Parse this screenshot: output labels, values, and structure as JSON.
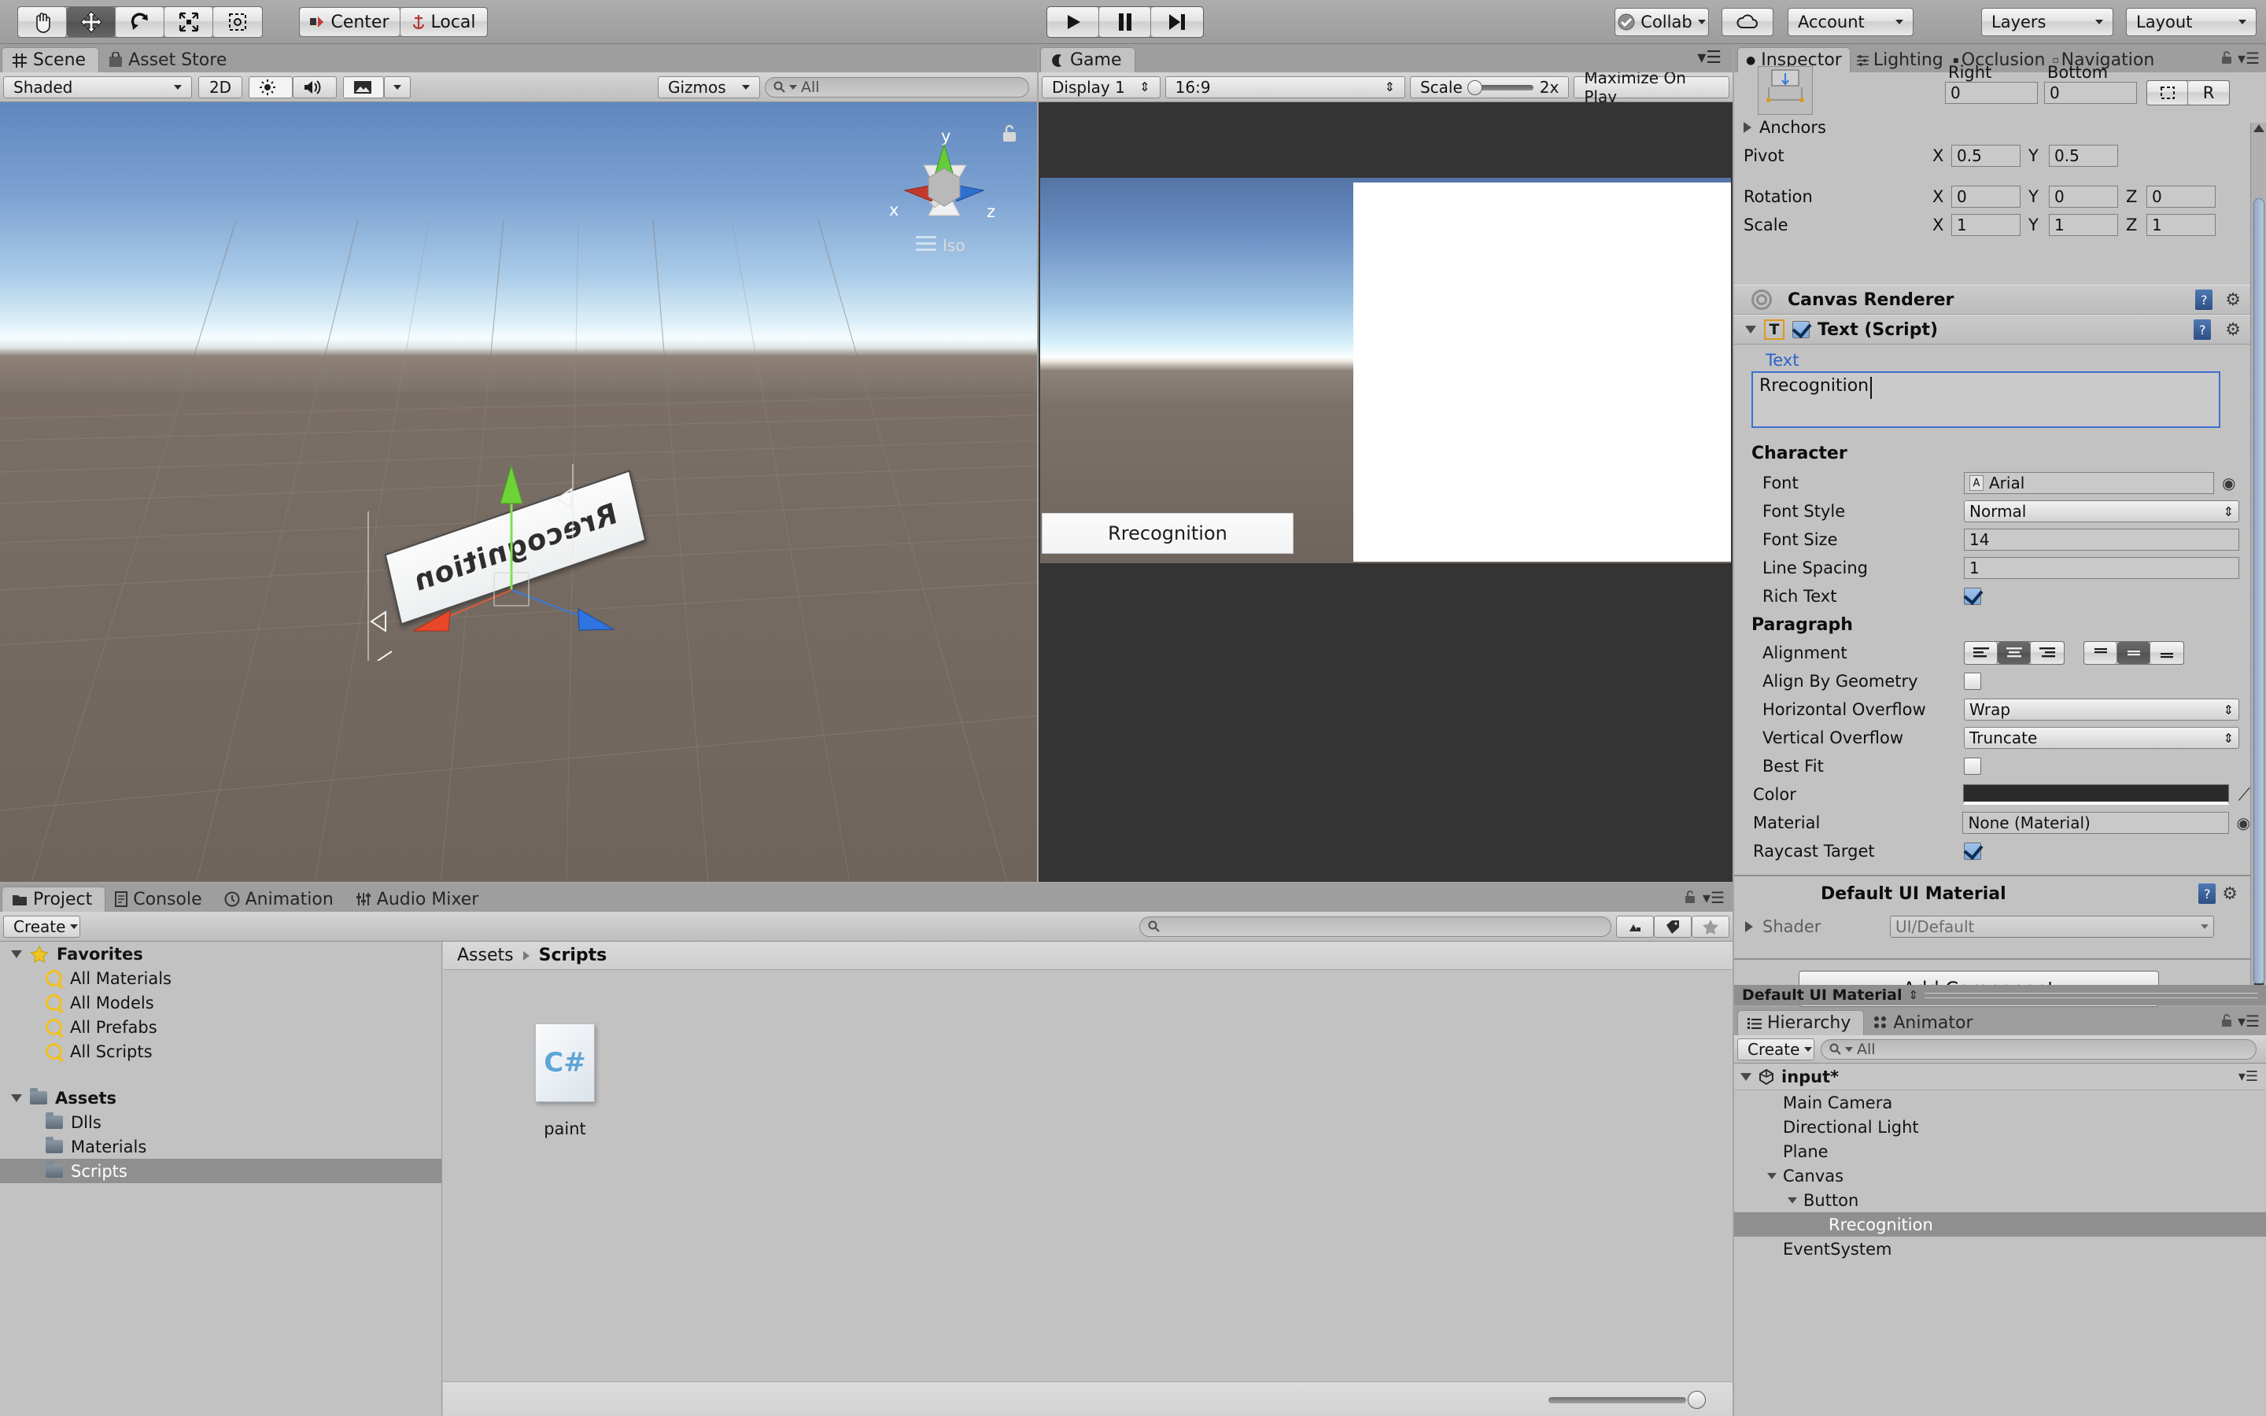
{
  "app": {
    "title": "Unity Editor"
  },
  "toolbar": {
    "tools": [
      {
        "name": "hand-tool",
        "glyph": "✋",
        "active": false
      },
      {
        "name": "move-tool",
        "glyph": "✥",
        "active": true
      },
      {
        "name": "rotate-tool",
        "glyph": "⟳",
        "active": false
      },
      {
        "name": "scale-tool",
        "glyph": "⤢",
        "active": false
      },
      {
        "name": "rect-tool",
        "glyph": "⊡",
        "active": false
      }
    ],
    "pivot_mode": "Center",
    "pivot_rotation": "Local",
    "play": "▶",
    "pause": "❚❚",
    "step": "▶❙",
    "collab": "Collab",
    "cloud": "cloud-icon",
    "account": "Account",
    "layers": "Layers",
    "layout": "Layout"
  },
  "scene_panel": {
    "tabs": [
      {
        "label": "Scene",
        "icon": "grid-icon",
        "active": true
      },
      {
        "label": "Asset Store",
        "icon": "store-icon",
        "active": false
      }
    ],
    "draw_mode": "Shaded",
    "two_d": "2D",
    "lighting_toggle": "light-icon",
    "audio_toggle": "audio-icon",
    "fx_toggle": "image-icon",
    "gizmos": "Gizmos",
    "search_placeholder": "All",
    "axis_gizmo": {
      "x": "x",
      "y": "y",
      "z": "z",
      "mode": "Iso"
    },
    "object_text": "Rrecognition"
  },
  "game_panel": {
    "tabs": [
      {
        "label": "Game",
        "icon": "gamepad-icon",
        "active": true
      }
    ],
    "display": "Display 1",
    "aspect": "16:9",
    "scale_label": "Scale",
    "scale_value": "2x",
    "maximize": "Maximize On Play",
    "button_label": "Rrecognition"
  },
  "inspector": {
    "tabs": [
      {
        "label": "Inspector",
        "icon": "info-icon",
        "active": true
      },
      {
        "label": "Lighting",
        "icon": "lighting-icon",
        "active": false
      },
      {
        "label": "Occlusion",
        "icon": "occlusion-icon",
        "active": false
      },
      {
        "label": "Navigation",
        "icon": "navigation-icon",
        "active": false
      }
    ],
    "rect": {
      "right_label": "Right",
      "bottom_label": "Bottom",
      "right_value": "0",
      "bottom_value": "0",
      "blueprint_btn": "blueprint-icon",
      "raw_btn": "R"
    },
    "anchors_label": "Anchors",
    "pivot": {
      "label": "Pivot",
      "x_label": "X",
      "x": "0.5",
      "y_label": "Y",
      "y": "0.5"
    },
    "rotation": {
      "label": "Rotation",
      "x_label": "X",
      "x": "0",
      "y_label": "Y",
      "y": "0",
      "z_label": "Z",
      "z": "0"
    },
    "scale": {
      "label": "Scale",
      "x_label": "X",
      "x": "1",
      "y_label": "Y",
      "y": "1",
      "z_label": "Z",
      "z": "1"
    },
    "canvas_renderer": "Canvas Renderer",
    "text_script": "Text (Script)",
    "text_field_label": "Text",
    "text_value": "Rrecognition",
    "character_header": "Character",
    "font_label": "Font",
    "font_value": "Arial",
    "font_style_label": "Font Style",
    "font_style_value": "Normal",
    "font_size_label": "Font Size",
    "font_size_value": "14",
    "line_spacing_label": "Line Spacing",
    "line_spacing_value": "1",
    "rich_text_label": "Rich Text",
    "paragraph_header": "Paragraph",
    "alignment_label": "Alignment",
    "align_by_geometry_label": "Align By Geometry",
    "horizontal_overflow_label": "Horizontal Overflow",
    "horizontal_overflow_value": "Wrap",
    "vertical_overflow_label": "Vertical Overflow",
    "vertical_overflow_value": "Truncate",
    "best_fit_label": "Best Fit",
    "color_label": "Color",
    "color_value": "#2b2b2b",
    "material_label": "Material",
    "material_value": "None (Material)",
    "raycast_target_label": "Raycast Target",
    "default_ui_material": "Default UI Material",
    "shader_label": "Shader",
    "shader_value": "UI/Default",
    "add_component": "Add Component",
    "footer_material": "Default UI Material"
  },
  "hierarchy": {
    "tabs": [
      {
        "label": "Hierarchy",
        "icon": "list-icon",
        "active": true
      },
      {
        "label": "Animator",
        "icon": "animator-icon",
        "active": false
      }
    ],
    "create": "Create",
    "search_placeholder": "All",
    "scene_name": "input*",
    "items": [
      {
        "label": "Main Camera",
        "depth": 1,
        "expand": "none",
        "selected": false
      },
      {
        "label": "Directional Light",
        "depth": 1,
        "expand": "none",
        "selected": false
      },
      {
        "label": "Plane",
        "depth": 1,
        "expand": "none",
        "selected": false
      },
      {
        "label": "Canvas",
        "depth": 1,
        "expand": "open",
        "selected": false
      },
      {
        "label": "Button",
        "depth": 2,
        "expand": "open",
        "selected": false
      },
      {
        "label": "Rrecognition",
        "depth": 3,
        "expand": "none",
        "selected": true
      },
      {
        "label": "EventSystem",
        "depth": 1,
        "expand": "none",
        "selected": false
      }
    ]
  },
  "project": {
    "tabs": [
      {
        "label": "Project",
        "icon": "folder-icon",
        "active": true
      },
      {
        "label": "Console",
        "icon": "console-icon",
        "active": false
      },
      {
        "label": "Animation",
        "icon": "clock-icon",
        "active": false
      },
      {
        "label": "Audio Mixer",
        "icon": "mixer-icon",
        "active": false
      }
    ],
    "create": "Create",
    "search_placeholder": "",
    "tree": [
      {
        "label": "Favorites",
        "kind": "star",
        "depth": 0,
        "bold": true,
        "expand": "open",
        "selected": false
      },
      {
        "label": "All Materials",
        "kind": "search",
        "depth": 1,
        "bold": false,
        "expand": "none",
        "selected": false
      },
      {
        "label": "All Models",
        "kind": "search",
        "depth": 1,
        "bold": false,
        "expand": "none",
        "selected": false
      },
      {
        "label": "All Prefabs",
        "kind": "search",
        "depth": 1,
        "bold": false,
        "expand": "none",
        "selected": false
      },
      {
        "label": "All Scripts",
        "kind": "search",
        "depth": 1,
        "bold": false,
        "expand": "none",
        "selected": false
      },
      {
        "label": "",
        "kind": "spacer",
        "depth": 0,
        "bold": false,
        "expand": "none",
        "selected": false
      },
      {
        "label": "Assets",
        "kind": "folder",
        "depth": 0,
        "bold": true,
        "expand": "open",
        "selected": false
      },
      {
        "label": "Dlls",
        "kind": "folder",
        "depth": 1,
        "bold": false,
        "expand": "none",
        "selected": false
      },
      {
        "label": "Materials",
        "kind": "folder",
        "depth": 1,
        "bold": false,
        "expand": "none",
        "selected": false
      },
      {
        "label": "Scripts",
        "kind": "folder",
        "depth": 1,
        "bold": false,
        "expand": "none",
        "selected": true
      }
    ],
    "breadcrumb": [
      "Assets",
      "Scripts"
    ],
    "assets": [
      {
        "label": "paint",
        "type": "C#"
      }
    ]
  }
}
